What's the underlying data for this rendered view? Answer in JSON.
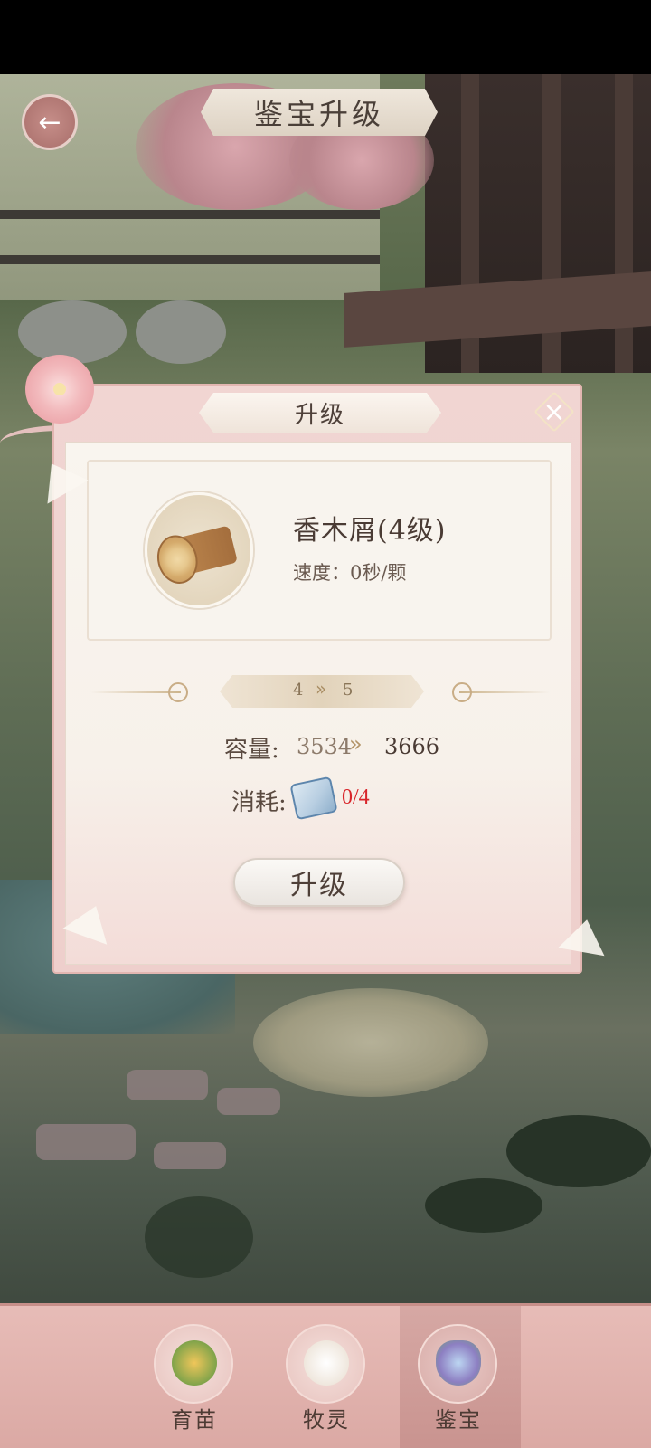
{
  "header": {
    "title": "鉴宝升级"
  },
  "dialog": {
    "title": "升级",
    "item": {
      "name": "香木屑(4级)",
      "speed": "速度：0秒/颗"
    },
    "level": {
      "from": "4",
      "arrow": "»",
      "to": "5"
    },
    "capacity": {
      "label": "容量:",
      "from": "3534",
      "arrow": "»",
      "to": "3666"
    },
    "cost": {
      "label": "消耗:",
      "value": "0/4",
      "color": "#d8252a"
    },
    "upgrade_button": "升级"
  },
  "tabs": [
    {
      "label": "育苗",
      "icon": "seedling-icon",
      "active": false
    },
    {
      "label": "牧灵",
      "icon": "sheep-icon",
      "active": false
    },
    {
      "label": "鉴宝",
      "icon": "gem-icon",
      "active": true
    }
  ],
  "colors": {
    "accent": "#e7bcb7",
    "cost_warning": "#d8252a",
    "panel": "#f9f5ef"
  }
}
